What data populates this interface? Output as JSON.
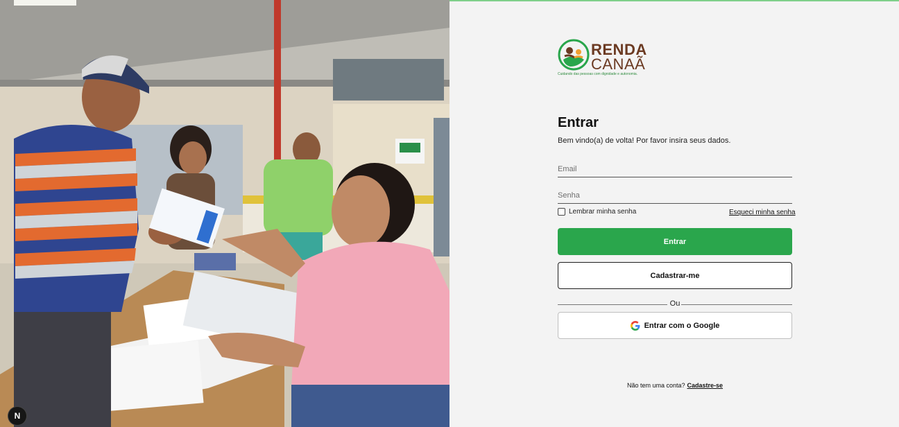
{
  "photo": {
    "alt_badge": "N"
  },
  "brand": {
    "name_line1": "RENDA",
    "name_line2": "CANAÃ",
    "tagline": "Cuidando das pessoas com dignidade e autonomia.",
    "colors": {
      "green": "#2aa64c",
      "brown": "#6b3a22",
      "orange": "#f0a030"
    }
  },
  "form": {
    "title": "Entrar",
    "subtitle": "Bem vindo(a) de volta! Por favor insira seus dados.",
    "email_placeholder": "Email",
    "email_value": "",
    "password_placeholder": "Senha",
    "password_value": "",
    "remember_label": "Lembrar minha senha",
    "remember_checked": false,
    "forgot_label": "Esqueci minha senha",
    "submit_label": "Entrar",
    "register_label": "Cadastrar-me",
    "divider_label": "Ou",
    "google_label": "Entrar com o Google",
    "google_icon": "google-g-icon"
  },
  "footer": {
    "question": "Não tem uma conta?",
    "signup_link": "Cadastre-se"
  }
}
